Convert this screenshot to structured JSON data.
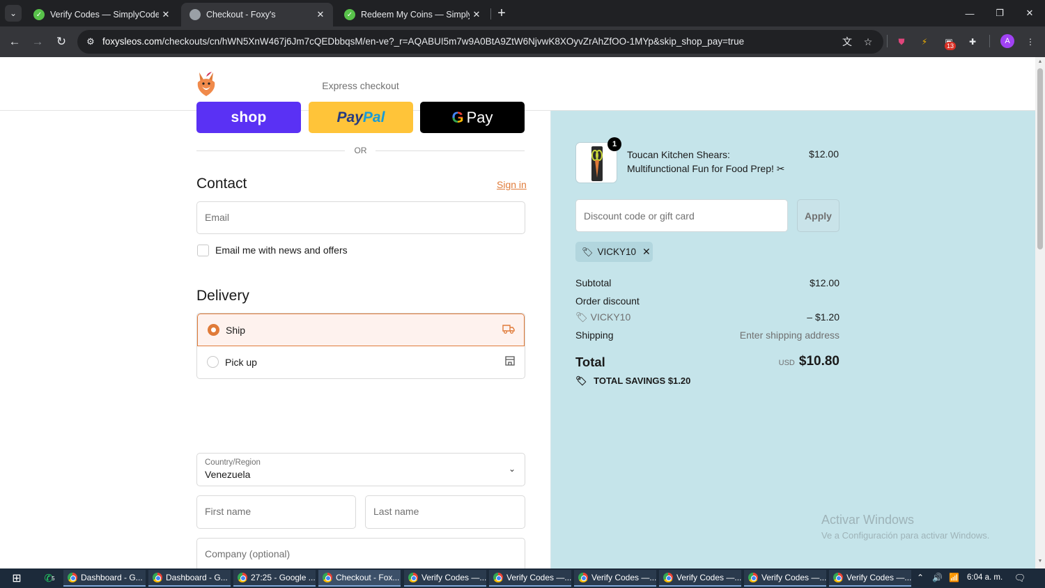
{
  "browser": {
    "tabs": [
      {
        "label": "Verify Codes — SimplyCodes",
        "icon": "simplycodes-icon",
        "active": false
      },
      {
        "label": "Checkout - Foxy's",
        "icon": "globe-icon",
        "active": true
      },
      {
        "label": "Redeem My Coins — SimplyCodes",
        "icon": "simplycodes-icon",
        "active": false
      }
    ],
    "new_tab_glyph": "+",
    "url_host": "foxysleos.com",
    "url_path": "/checkouts/cn/hWN5XnW467j6Jm7cQEDbbqsM/en-ve?_r=AQABUI5m7w9A0BtA9ZtW6NjvwK8XOyvZrAhZfOO-1MYp&skip_shop_pay=true",
    "extension_badge": "13",
    "profile_initial": "A"
  },
  "checkout": {
    "express_title": "Express checkout",
    "shop_label": "shop",
    "paypal_part1": "Pay",
    "paypal_part2": "Pal",
    "gpay_g": "G",
    "gpay_label": "Pay",
    "or_label": "OR",
    "contact_title": "Contact",
    "sign_in": "Sign in",
    "email_placeholder": "Email",
    "news_label": "Email me with news and offers",
    "delivery_title": "Delivery",
    "ship_label": "Ship",
    "pickup_label": "Pick up",
    "country_label": "Country/Region",
    "country_value": "Venezuela",
    "first_name_placeholder": "First name",
    "last_name_placeholder": "Last name",
    "company_placeholder": "Company (optional)"
  },
  "summary": {
    "quantity": "1",
    "product_name": "Toucan Kitchen Shears: Multifunctional Fun for Food Prep! ✂",
    "product_price": "$12.00",
    "discount_placeholder": "Discount code or gift card",
    "apply_label": "Apply",
    "code": "VICKY10",
    "subtotal_label": "Subtotal",
    "subtotal_value": "$12.00",
    "order_discount_label": "Order discount",
    "discount_code": "VICKY10",
    "discount_value": "– $1.20",
    "shipping_label": "Shipping",
    "shipping_value": "Enter shipping address",
    "total_label": "Total",
    "total_currency": "USD",
    "total_value": "$10.80",
    "savings_label": "TOTAL SAVINGS",
    "savings_value": "$1.20"
  },
  "watermark": {
    "line1": "Activar Windows",
    "line2": "Ve a Configuración para activar Windows."
  },
  "taskbar": {
    "whatsapp_badge": "5",
    "items": [
      {
        "label": "Dashboard - G...",
        "active": false
      },
      {
        "label": "Dashboard - G...",
        "active": false
      },
      {
        "label": "27:25 - Google ...",
        "active": false
      },
      {
        "label": "Checkout - Fox...",
        "active": true
      },
      {
        "label": "Verify Codes —...",
        "active": false
      },
      {
        "label": "Verify Codes —...",
        "active": false
      },
      {
        "label": "Verify Codes —...",
        "active": false
      },
      {
        "label": "Verify Codes —...",
        "active": false
      },
      {
        "label": "Verify Codes —...",
        "active": false
      },
      {
        "label": "Verify Codes —...",
        "active": false
      }
    ],
    "clock": "6:04 a. m."
  },
  "colors": {
    "accent": "#e07b39",
    "summary_bg": "#c5e4ea",
    "shop_purple": "#5a31f4",
    "paypal_yellow": "#ffc439"
  }
}
